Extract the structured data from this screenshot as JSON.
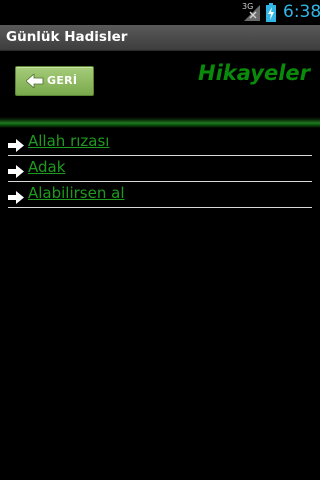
{
  "status_bar": {
    "network_label": "3G",
    "time": "6:38",
    "time_color": "#33b5e5"
  },
  "title_bar": {
    "title": "Günlük Hadisler"
  },
  "header": {
    "back_button_label": "GERİ",
    "back_icon": "left-arrow-icon",
    "section_title": "Hikayeler",
    "section_title_color": "#0a8a0a"
  },
  "list": {
    "item_icon": "right-arrow-icon",
    "items": [
      {
        "label": "Allah rızası"
      },
      {
        "label": "Adak"
      },
      {
        "label": "Alabilirsen al"
      }
    ]
  },
  "colors": {
    "background": "#000000",
    "link": "#1e9a1e",
    "button_green": "#7aa94c"
  }
}
